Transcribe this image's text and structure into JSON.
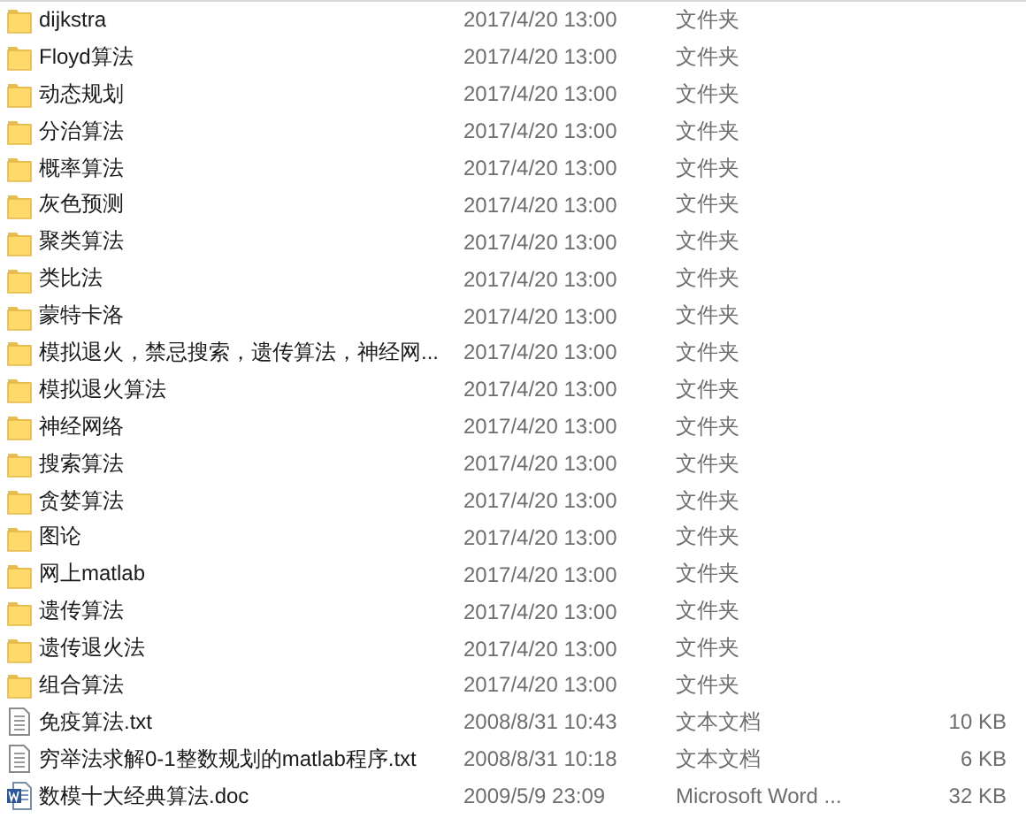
{
  "files": [
    {
      "kind": "folder",
      "name": "dijkstra",
      "modified": "2017/4/20 13:00",
      "type": "文件夹"
    },
    {
      "kind": "folder",
      "name": "Floyd算法",
      "modified": "2017/4/20 13:00",
      "type": "文件夹"
    },
    {
      "kind": "folder",
      "name": "动态规划",
      "modified": "2017/4/20 13:00",
      "type": "文件夹"
    },
    {
      "kind": "folder",
      "name": "分治算法",
      "modified": "2017/4/20 13:00",
      "type": "文件夹"
    },
    {
      "kind": "folder",
      "name": "概率算法",
      "modified": "2017/4/20 13:00",
      "type": "文件夹"
    },
    {
      "kind": "folder",
      "name": "灰色预测",
      "modified": "2017/4/20 13:00",
      "type": "文件夹"
    },
    {
      "kind": "folder",
      "name": "聚类算法",
      "modified": "2017/4/20 13:00",
      "type": "文件夹"
    },
    {
      "kind": "folder",
      "name": "类比法",
      "modified": "2017/4/20 13:00",
      "type": "文件夹"
    },
    {
      "kind": "folder",
      "name": "蒙特卡洛",
      "modified": "2017/4/20 13:00",
      "type": "文件夹"
    },
    {
      "kind": "folder",
      "name": "模拟退火，禁忌搜索，遗传算法，神经网...",
      "modified": "2017/4/20 13:00",
      "type": "文件夹"
    },
    {
      "kind": "folder",
      "name": "模拟退火算法",
      "modified": "2017/4/20 13:00",
      "type": "文件夹"
    },
    {
      "kind": "folder",
      "name": "神经网络",
      "modified": "2017/4/20 13:00",
      "type": "文件夹"
    },
    {
      "kind": "folder",
      "name": "搜索算法",
      "modified": "2017/4/20 13:00",
      "type": "文件夹"
    },
    {
      "kind": "folder",
      "name": "贪婪算法",
      "modified": "2017/4/20 13:00",
      "type": "文件夹"
    },
    {
      "kind": "folder",
      "name": "图论",
      "modified": "2017/4/20 13:00",
      "type": "文件夹"
    },
    {
      "kind": "folder",
      "name": "网上matlab",
      "modified": "2017/4/20 13:00",
      "type": "文件夹"
    },
    {
      "kind": "folder",
      "name": "遗传算法",
      "modified": "2017/4/20 13:00",
      "type": "文件夹"
    },
    {
      "kind": "folder",
      "name": "遗传退火法",
      "modified": "2017/4/20 13:00",
      "type": "文件夹"
    },
    {
      "kind": "folder",
      "name": "组合算法",
      "modified": "2017/4/20 13:00",
      "type": "文件夹"
    },
    {
      "kind": "text",
      "name": "免疫算法.txt",
      "modified": "2008/8/31 10:43",
      "type": "文本文档",
      "size": "10 KB"
    },
    {
      "kind": "text",
      "name": "穷举法求解0-1整数规划的matlab程序.txt",
      "modified": "2008/8/31 10:18",
      "type": "文本文档",
      "size": "6 KB"
    },
    {
      "kind": "word",
      "name": "数模十大经典算法.doc",
      "modified": "2009/5/9 23:09",
      "type": "Microsoft Word ...",
      "size": "32 KB"
    }
  ]
}
